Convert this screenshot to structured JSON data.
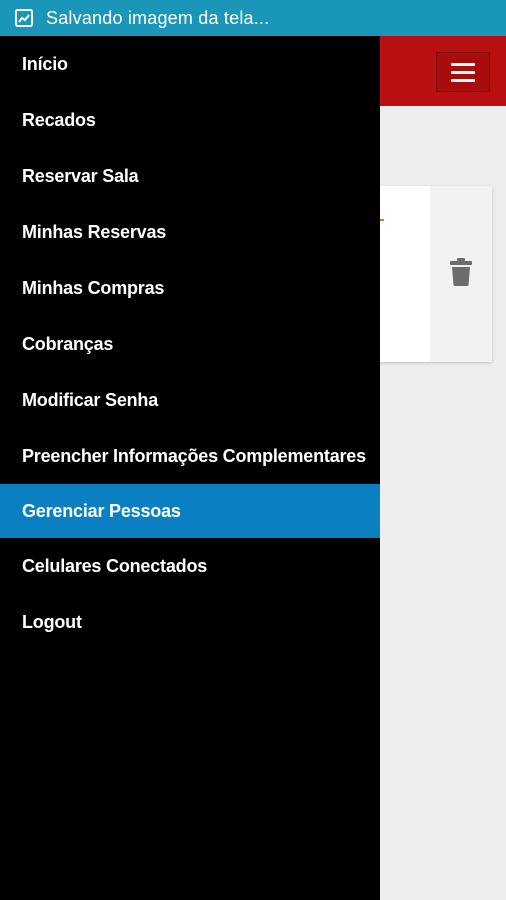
{
  "status_bar": {
    "icon": "screenshot-image-icon",
    "text": "Salvando imagem da tela..."
  },
  "header": {
    "menu_icon": "hamburger-menu-icon",
    "color": "#b80f10"
  },
  "card": {
    "action_icon": "trash-icon"
  },
  "drawer": {
    "items": [
      {
        "label": "Início",
        "active": false
      },
      {
        "label": "Recados",
        "active": false
      },
      {
        "label": "Reservar Sala",
        "active": false
      },
      {
        "label": "Minhas Reservas",
        "active": false
      },
      {
        "label": "Minhas Compras",
        "active": false
      },
      {
        "label": "Cobranças",
        "active": false
      },
      {
        "label": "Modificar Senha",
        "active": false
      },
      {
        "label": "Preencher Informações Complementares",
        "active": false
      },
      {
        "label": "Gerenciar Pessoas",
        "active": true
      },
      {
        "label": "Celulares Conectados",
        "active": false
      },
      {
        "label": "Logout",
        "active": false
      }
    ],
    "active_color": "#0a7fc2"
  }
}
